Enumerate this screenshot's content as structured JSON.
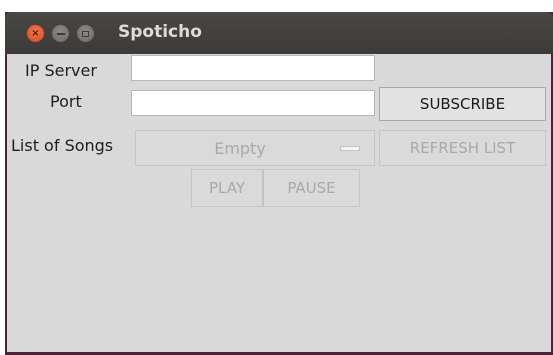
{
  "window": {
    "title": "Spoticho",
    "close_glyph": "×"
  },
  "form": {
    "ip_label": "IP Server",
    "ip_value": "",
    "port_label": "Port",
    "port_value": "",
    "songs_label": "List of Songs"
  },
  "buttons": {
    "subscribe": "SUBSCRIBE",
    "refresh": "REFRESH LIST",
    "play": "PLAY",
    "pause": "PAUSE"
  },
  "song_select": {
    "selected": "Empty"
  },
  "icons": {
    "close": "close-icon",
    "minimize": "minimize-icon",
    "maximize": "maximize-icon",
    "dropdown": "dropdown-indicator-icon"
  },
  "colors": {
    "titlebar": "#3c3b37",
    "close_button": "#e95420",
    "window_border": "#4d2336",
    "content_bg": "#d9d9d9",
    "disabled_text": "#a9a9a9"
  }
}
